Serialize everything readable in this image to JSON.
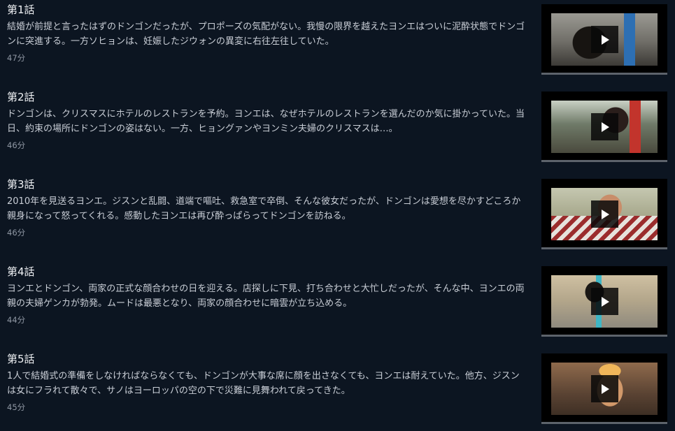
{
  "episodes": [
    {
      "title": "第1話",
      "description": "結婚が前提と言ったはずのドンゴンだったが、プロポーズの気配がない。我慢の限界を越えたヨンエはついに泥酔状態でドンゴンに突進する。一方ソヒョンは、妊娠したジウォンの異変に右往左往していた。",
      "duration": "47分",
      "thumbnail_icon": "play-icon"
    },
    {
      "title": "第2話",
      "description": "ドンゴンは、クリスマスにホテルのレストランを予約。ヨンエは、なぜホテルのレストランを選んだのか気に掛かっていた。当日、約束の場所にドンゴンの姿はない。一方、ヒョングァンやヨンミン夫婦のクリスマスは…。",
      "duration": "46分",
      "thumbnail_icon": "play-icon"
    },
    {
      "title": "第3話",
      "description": "2010年を見送るヨンエ。ジスンと乱闘、道端で嘔吐、救急室で卒倒、そんな彼女だったが、ドンゴンは愛想を尽かすどころか親身になって怒ってくれる。感動したヨンエは再び酔っぱらってドンゴンを訪ねる。",
      "duration": "46分",
      "thumbnail_icon": "play-icon"
    },
    {
      "title": "第4話",
      "description": "ヨンエとドンゴン、両家の正式な顔合わせの日を迎える。店探しに下見、打ち合わせと大忙しだったが、そんな中、ヨンエの両親の夫婦ゲンカが勃発。ムードは最悪となり、両家の顔合わせに暗雲が立ち込める。",
      "duration": "44分",
      "thumbnail_icon": "play-icon"
    },
    {
      "title": "第5話",
      "description": "1人で結婚式の準備をしなければならなくても、ドンゴンが大事な席に顔を出さなくても、ヨンエは耐えていた。他方、ジスンは女にフラれて散々で、サノはヨーロッパの空の下で災難に見舞われて戻ってきた。",
      "duration": "45分",
      "thumbnail_icon": "play-icon"
    }
  ],
  "colors": {
    "background": "#0c1521",
    "title_text": "#f0f2f5",
    "description_text": "#c9ced6",
    "duration_text": "#8f97a3",
    "thumbnail_frame": "#000000",
    "play_button": "#080808"
  }
}
